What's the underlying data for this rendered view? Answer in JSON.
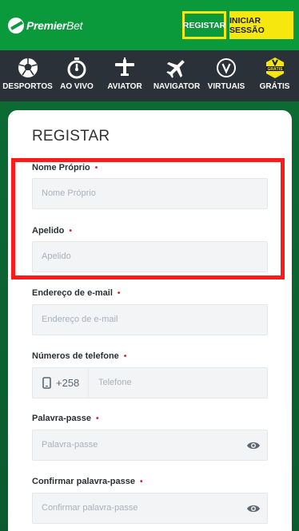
{
  "header": {
    "logo_primary": "Premier",
    "logo_secondary": "Bet",
    "register_label": "REGISTAR",
    "login_label": "INICIAR SESSÃO"
  },
  "nav": {
    "items": [
      {
        "label": "DESPORTOS",
        "icon": "soccer-ball-icon"
      },
      {
        "label": "AO VIVO",
        "icon": "stopwatch-icon"
      },
      {
        "label": "AVIATOR",
        "icon": "propeller-plane-icon"
      },
      {
        "label": "NAVIGATOR",
        "icon": "airplane-icon"
      },
      {
        "label": "VIRTUAIS",
        "icon": "virtual-v-icon"
      },
      {
        "label": "GRÁTIS",
        "icon": "free-bet-badge-icon",
        "badge": "GRÁTIS"
      }
    ]
  },
  "form": {
    "title": "REGISTAR",
    "required_marker": "•",
    "first_name": {
      "label": "Nome Próprio",
      "placeholder": "Nome Próprio",
      "value": ""
    },
    "last_name": {
      "label": "Apelido",
      "placeholder": "Apelido",
      "value": ""
    },
    "email": {
      "label": "Endereço de e-mail",
      "placeholder": "Endereço de e-mail",
      "value": ""
    },
    "phone": {
      "label": "Números de telefone",
      "prefix": "+258",
      "placeholder": "Telefone",
      "value": ""
    },
    "password": {
      "label": "Palavra-passe",
      "placeholder": "Palavra-passe",
      "value": ""
    },
    "confirm_password": {
      "label": "Confirmar palavra-passe",
      "placeholder": "Confirmar palavra-passe",
      "value": ""
    }
  },
  "colors": {
    "brand_green": "#0a9a3c",
    "accent_yellow": "#f6e80f",
    "nav_bg": "#2a3138",
    "highlight_red": "#ff1a1a"
  }
}
